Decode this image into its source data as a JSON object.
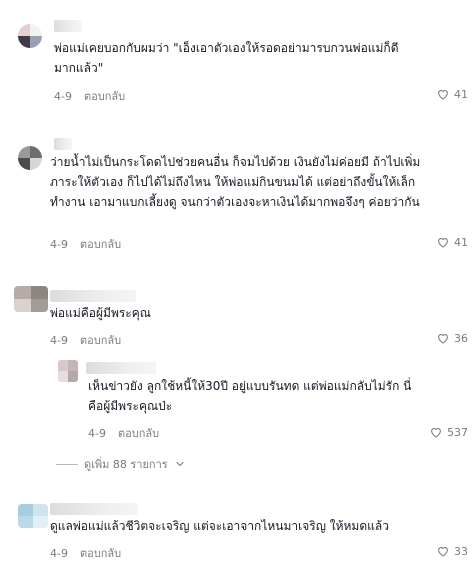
{
  "comments": [
    {
      "text": "พ่อแม่เคยบอกกับผมว่า \"เอ็งเอาตัวเองให้รอดอย่ามารบกวนพ่อแม่ก็ดีมากแล้ว\"",
      "date": "4-9",
      "reply_label": "ตอบกลับ",
      "likes": "41"
    },
    {
      "text": "ว่ายน้ำไม่เป็นกระโดดไปช่วยคนอื่น ก็จมไปด้วย เงินยังไม่ค่อยมี ถ้าไปเพิ่มภาระให้ตัวเอง ก็ไปได้ไม่ถึงไหน ให้พ่อแม่กินขนมได้ แต่อย่าถึงขั้นให้เล็กทำงาน เอามาแบกเลี้ยงดู จนกว่าตัวเองจะหาเงินได้มากพอจึงๆ ค่อยว่ากัน",
      "date": "4-9",
      "reply_label": "ตอบกลับ",
      "likes": "41"
    },
    {
      "text": "พ่อแม่คือผู้มีพระคุณ",
      "date": "4-9",
      "reply_label": "ตอบกลับ",
      "likes": "36"
    },
    {
      "text": "เห็นข่าวยัง ลูกใช้หนี้ให้30ปี อยู่แบบรันทด แต่พ่อแม่กลับไม่รัก นี่คือผู้มีพระคุณป่ะ",
      "date": "4-9",
      "reply_label": "ตอบกลับ",
      "likes": "537"
    },
    {
      "text": "ดูแลพ่อแม่แล้วชีวิตจะเจริญ แต่จะเอาจากไหนมาเจริญ ให้หมดแล้ว",
      "date": "4-9",
      "reply_label": "ตอบกลับ",
      "likes": "33"
    }
  ],
  "view_more_label": "ดูเพิ่ม 88 รายการ",
  "icons": {
    "like": "heart-outline-icon",
    "expand": "chevron-down-icon"
  },
  "colors": {
    "text": "#161823",
    "meta": "#7a7b82",
    "background": "#ffffff"
  }
}
